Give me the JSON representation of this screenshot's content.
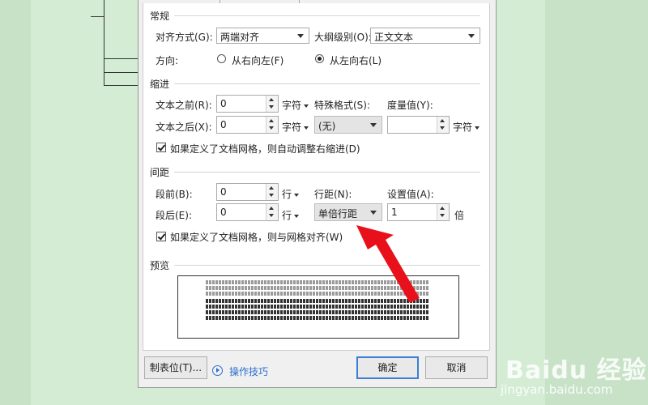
{
  "colors": {
    "background": "#c8e2c8",
    "accent": "#3c7fd2",
    "link": "#2a6fcf",
    "arrow": "#e8101a"
  },
  "general": {
    "title": "常规",
    "alignment_label": "对齐方式(G):",
    "alignment_value": "两端对齐",
    "outline_label": "大纲级别(O):",
    "outline_value": "正文文本",
    "direction_label": "方向:",
    "rtl_label": "从右向左(F)",
    "ltr_label": "从左向右(L)",
    "direction_selected": "ltr"
  },
  "indent": {
    "title": "缩进",
    "before_label": "文本之前(R):",
    "before_value": "0",
    "before_unit": "字符",
    "after_label": "文本之后(X):",
    "after_value": "0",
    "after_unit": "字符",
    "special_label": "特殊格式(S):",
    "special_value": "(无)",
    "measure_label": "度量值(Y):",
    "measure_value": "",
    "measure_unit": "字符",
    "auto_adjust_label": "如果定义了文档网格，则自动调整右缩进(D)",
    "auto_adjust_checked": true
  },
  "spacing": {
    "title": "间距",
    "before_label": "段前(B):",
    "before_value": "0",
    "before_unit": "行",
    "after_label": "段后(E):",
    "after_value": "0",
    "after_unit": "行",
    "line_label": "行距(N):",
    "line_value": "单倍行距",
    "setting_label": "设置值(A):",
    "setting_value": "1",
    "setting_unit": "倍",
    "grid_align_label": "如果定义了文档网格，则与网格对齐(W)",
    "grid_align_checked": true
  },
  "preview": {
    "title": "预览"
  },
  "buttons": {
    "tabs": "制表位(T)...",
    "tips": "操作技巧",
    "ok": "确定",
    "cancel": "取消"
  },
  "watermark": {
    "brand": "Baidu 经验",
    "url": "jingyan.baidu.com"
  }
}
